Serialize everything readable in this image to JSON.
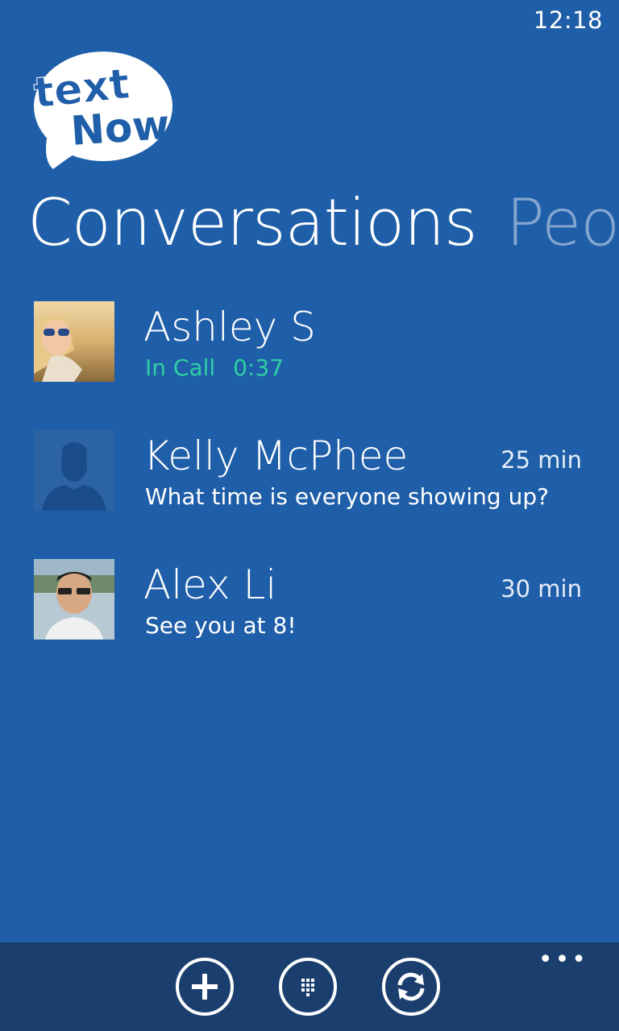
{
  "status": {
    "time": "12:18"
  },
  "logo": {
    "line1": "text",
    "line2": "Now"
  },
  "pivot": {
    "active": "Conversations",
    "inactive": "Peo"
  },
  "conversations": [
    {
      "name": "Ashley S",
      "status": "In Call",
      "duration": "0:37",
      "time": ""
    },
    {
      "name": "Kelly McPhee",
      "preview": "What time is everyone showing up?",
      "time": "25 min"
    },
    {
      "name": "Alex Li",
      "preview": "See you at 8!",
      "time": "30 min"
    }
  ],
  "appbar": {
    "buttons": [
      "new-message-icon",
      "dialpad-icon",
      "refresh-icon"
    ],
    "more": "•••"
  },
  "colors": {
    "background": "#1f5ea8",
    "appbar": "#1a3f6f",
    "in_call": "#2ed0a3"
  }
}
